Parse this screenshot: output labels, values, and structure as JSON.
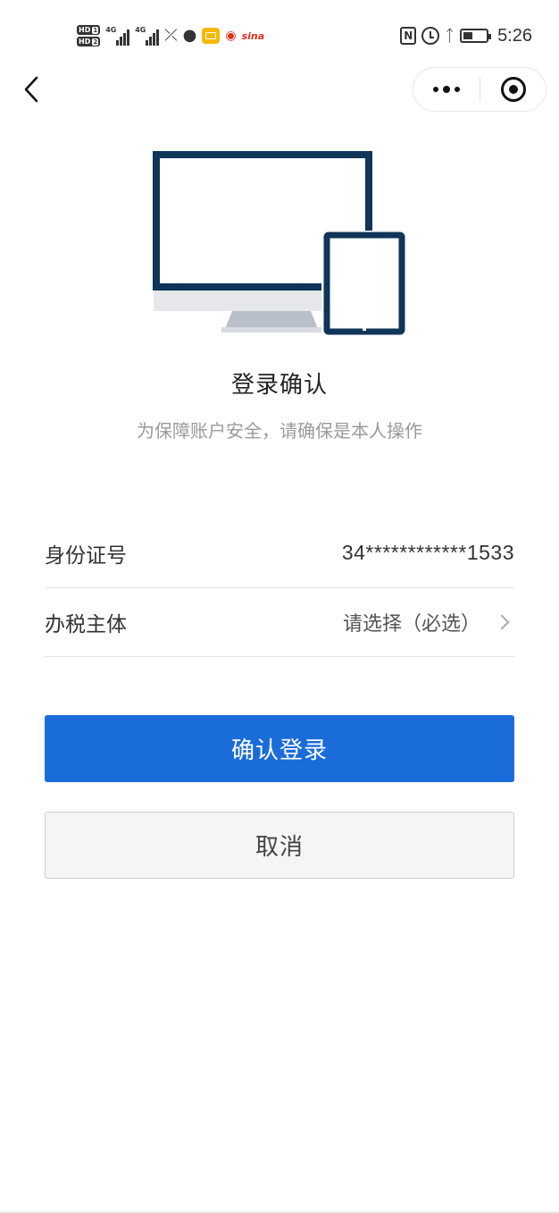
{
  "status_bar": {
    "network_1": "4G",
    "network_2": "4G",
    "hd_1": "HD",
    "hd_2": "HD",
    "sim_1": "1",
    "sim_2": "2",
    "weibo": "sina",
    "nfc": "N",
    "time": "5:26",
    "battery_level": 0.4
  },
  "nav": {
    "back_icon": "chevron-left-icon",
    "more_icon": "more-dots-icon",
    "close_icon": "target-circle-icon"
  },
  "colors": {
    "primary": "#1a6dd9",
    "illustration_dark": "#0f3558",
    "background": "#ffffff"
  },
  "header": {
    "title": "登录确认",
    "subtitle": "为保障账户安全，请确保是本人操作"
  },
  "form": {
    "id_label": "身份证号",
    "id_value": "34************1533",
    "entity_label": "办税主体",
    "entity_placeholder": "请选择（必选）"
  },
  "actions": {
    "confirm_label": "确认登录",
    "cancel_label": "取消"
  }
}
